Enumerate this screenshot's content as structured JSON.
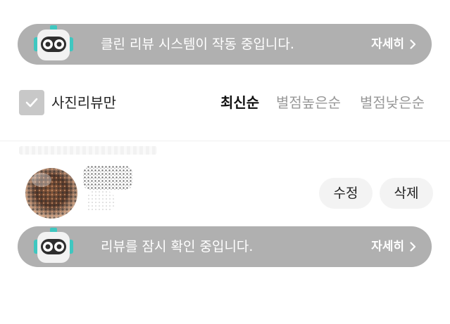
{
  "banner_top": {
    "message": "클린 리뷰 시스템이 작동 중입니다.",
    "more_label": "자세히"
  },
  "filter": {
    "photo_only_label": "사진리뷰만",
    "photo_only_checked": true,
    "sort_options": [
      "최신순",
      "별점높은순",
      "별점낮은순"
    ],
    "active_sort": "최신순"
  },
  "review": {
    "edit_label": "수정",
    "delete_label": "삭제"
  },
  "banner_bottom": {
    "message": "리뷰를 잠시 확인 중입니다.",
    "more_label": "자세히"
  },
  "colors": {
    "banner_bg": "#b0b0b0",
    "robot_accent": "#3fc7c0",
    "pill_bg": "#f3f3f3"
  }
}
